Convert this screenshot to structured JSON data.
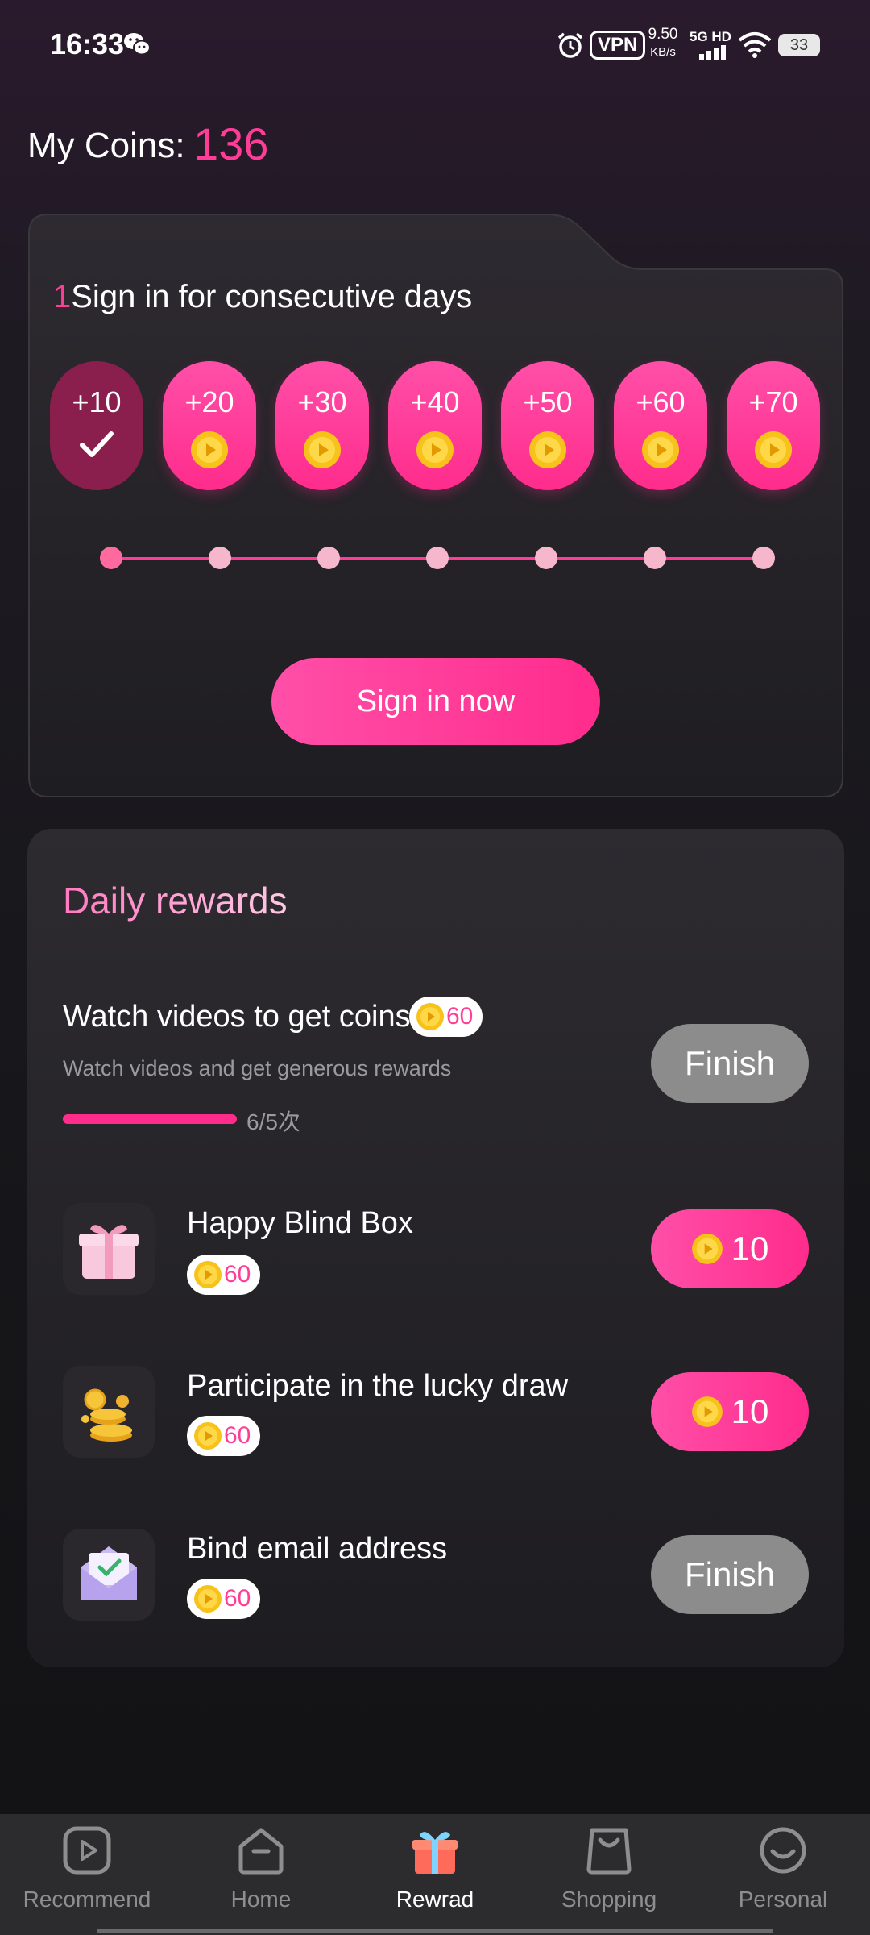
{
  "status_bar": {
    "time": "16:33",
    "vpn": "VPN",
    "speed_value": "9.50",
    "speed_unit": "KB/s",
    "network": "5G HD",
    "battery": "33"
  },
  "coins": {
    "label": "My Coins:",
    "value": "136"
  },
  "signin": {
    "title_number": "1",
    "title": "Sign in for consecutive days",
    "days": [
      {
        "amount": "+10",
        "done": true
      },
      {
        "amount": "+20",
        "done": false
      },
      {
        "amount": "+30",
        "done": false
      },
      {
        "amount": "+40",
        "done": false
      },
      {
        "amount": "+50",
        "done": false
      },
      {
        "amount": "+60",
        "done": false
      },
      {
        "amount": "+70",
        "done": false
      }
    ],
    "button": "Sign in now"
  },
  "daily": {
    "title": "Daily rewards",
    "tasks": [
      {
        "title": "Watch videos to get coins",
        "reward": "60",
        "subtitle": "Watch videos and get generous rewards",
        "progress": 1.0,
        "progress_text": "6/5次",
        "button": "Finish",
        "button_state": "finished"
      },
      {
        "title": "Happy Blind Box",
        "reward": "60",
        "button": "10",
        "button_state": "active",
        "icon": "gift-box-icon"
      },
      {
        "title": "Participate in the lucky draw",
        "reward": "60",
        "button": "10",
        "button_state": "active",
        "icon": "coin-stack-icon"
      },
      {
        "title": "Bind email address",
        "reward": "60",
        "button": "Finish",
        "button_state": "finished",
        "icon": "envelope-check-icon"
      }
    ]
  },
  "nav": {
    "items": [
      {
        "label": "Recommend",
        "icon": "play-square-icon"
      },
      {
        "label": "Home",
        "icon": "home-icon"
      },
      {
        "label": "Rewrad",
        "icon": "gift-icon",
        "active": true
      },
      {
        "label": "Shopping",
        "icon": "shopping-bag-icon"
      },
      {
        "label": "Personal",
        "icon": "smile-face-icon"
      }
    ]
  },
  "colors": {
    "accent": "#ff3d96",
    "finished_button": "#8c8c8c",
    "background": "#18181c"
  }
}
